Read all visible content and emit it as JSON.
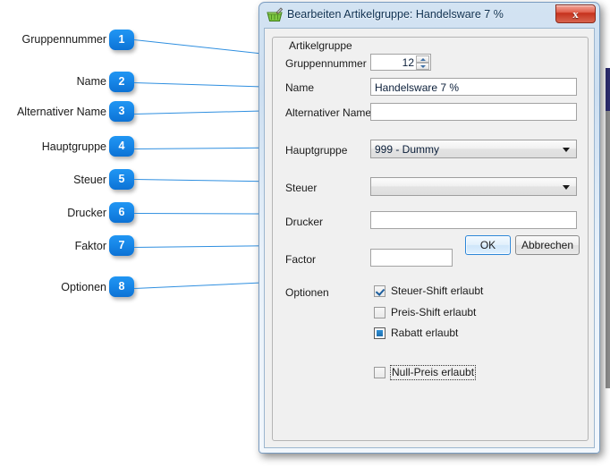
{
  "annotations": [
    {
      "number": "1",
      "label": "Gruppennummer"
    },
    {
      "number": "2",
      "label": "Name"
    },
    {
      "number": "3",
      "label": "Alternativer Name"
    },
    {
      "number": "4",
      "label": "Hauptgruppe"
    },
    {
      "number": "5",
      "label": "Steuer"
    },
    {
      "number": "6",
      "label": "Drucker"
    },
    {
      "number": "7",
      "label": "Faktor"
    },
    {
      "number": "8",
      "label": "Optionen"
    }
  ],
  "window": {
    "title": "Bearbeiten Artikelgruppe: Handelsware 7 %",
    "icon": "basket-edit-icon",
    "close_label": "x",
    "accent_color": "#2f8fe0"
  },
  "groupbox": {
    "title": "Artikelgruppe"
  },
  "form": {
    "gruppennummer": {
      "label": "Gruppennummer",
      "value": "12"
    },
    "name": {
      "label": "Name",
      "value": "Handelsware 7 %",
      "placeholder": ""
    },
    "alternativer_name": {
      "label": "Alternativer Name",
      "value": "",
      "placeholder": ""
    },
    "hauptgruppe": {
      "label": "Hauptgruppe",
      "value": "999 - Dummy"
    },
    "steuer": {
      "label": "Steuer",
      "value": ""
    },
    "drucker": {
      "label": "Drucker",
      "value": "",
      "placeholder": ""
    },
    "factor": {
      "label": "Factor",
      "value": "",
      "placeholder": ""
    },
    "optionen": {
      "label": "Optionen"
    }
  },
  "buttons": {
    "ok": "OK",
    "cancel": "Abbrechen"
  },
  "checkboxes": [
    {
      "label": "Steuer-Shift erlaubt",
      "state": "checked"
    },
    {
      "label": "Preis-Shift erlaubt",
      "state": "unchecked"
    },
    {
      "label": "Rabatt erlaubt",
      "state": "filled"
    },
    {
      "label": "Null-Preis erlaubt",
      "state": "unchecked-focused"
    }
  ]
}
